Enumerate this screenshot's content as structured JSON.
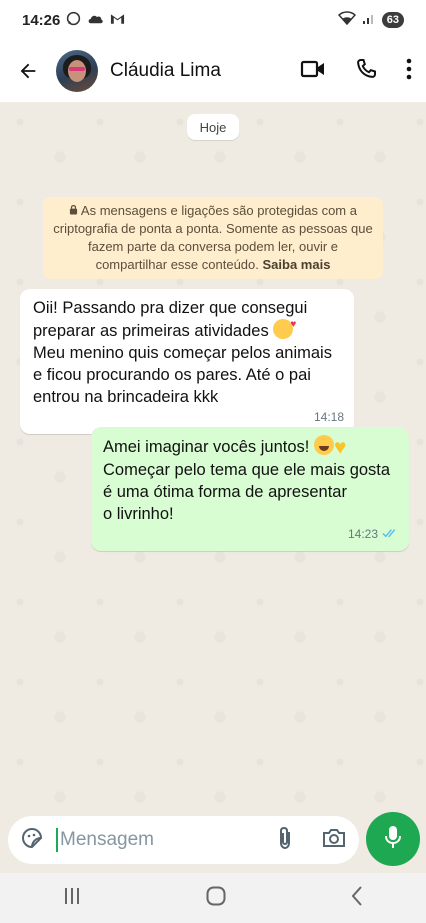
{
  "status_bar": {
    "time": "14:26",
    "battery": "63"
  },
  "header": {
    "contact_name": "Cláudia Lima"
  },
  "chat": {
    "date_chip": "Hoje",
    "encryption_notice": {
      "text": "As mensagens e ligações são protegidas com a criptografia de ponta a ponta. Somente as pessoas que fazem parte da conversa podem ler, ouvir e compartilhar esse conteúdo.",
      "link": "Saiba mais"
    },
    "messages": [
      {
        "direction": "incoming",
        "line1": "Oii! Passando pra dizer que consegui",
        "line2": "preparar as primeiras atividades",
        "line3": "Meu menino quis começar pelos animais",
        "line4": "e ficou procurando os pares. Até o pai",
        "line5": "entrou na brincadeira kkk",
        "time": "14:18"
      },
      {
        "direction": "outgoing",
        "line1": "Amei imaginar vocês juntos!",
        "line2": "Começar pelo tema que ele mais gosta",
        "line3": "é uma ótima forma de apresentar",
        "line4": "o livrinho!",
        "time": "14:23",
        "status": "read"
      }
    ]
  },
  "composer": {
    "placeholder": "Mensagem"
  },
  "colors": {
    "chat_background": "#efeae2",
    "outgoing_bubble": "#d9fdd3",
    "accent_green": "#1da851",
    "read_ticks": "#53bdeb",
    "encryption_background": "#ffeecd"
  },
  "icons": {
    "status": [
      "whatsapp-icon",
      "cloud-icon",
      "gmail-icon",
      "wifi-icon",
      "signal-icon",
      "battery-icon"
    ],
    "header": [
      "back-arrow-icon",
      "video-call-icon",
      "phone-icon",
      "more-vert-icon"
    ],
    "composer": [
      "sticker-icon",
      "attach-icon",
      "camera-icon",
      "mic-icon"
    ],
    "navigation": [
      "recents-icon",
      "home-icon",
      "back-icon"
    ]
  }
}
